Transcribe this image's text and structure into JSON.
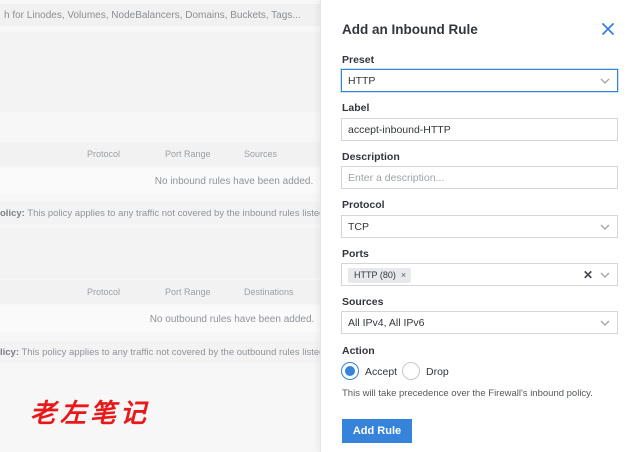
{
  "background": {
    "search_text": "h for Linodes, Volumes, NodeBalancers, Domains, Buckets, Tags...",
    "inbound_headers": [
      "Protocol",
      "Port Range",
      "Sources"
    ],
    "inbound_empty": "No inbound rules have been added.",
    "inbound_policy_label": "olicy:",
    "inbound_policy_text": " This policy applies to any traffic not covered by the inbound rules listed a",
    "outbound_headers": [
      "Protocol",
      "Port Range",
      "Destinations"
    ],
    "outbound_empty": "No outbound rules have been added.",
    "outbound_policy_label": "licy:",
    "outbound_policy_text": " This policy applies to any traffic not covered by the outbound rules listed a",
    "watermark": "老左笔记"
  },
  "drawer": {
    "title": "Add an Inbound Rule",
    "close_icon": "close-icon",
    "preset": {
      "label": "Preset",
      "value": "HTTP"
    },
    "label_field": {
      "label": "Label",
      "value": "accept-inbound-HTTP"
    },
    "description": {
      "label": "Description",
      "placeholder": "Enter a description..."
    },
    "protocol": {
      "label": "Protocol",
      "value": "TCP"
    },
    "ports": {
      "label": "Ports",
      "chip": "HTTP (80)",
      "chip_remove": "×",
      "clear": "✕"
    },
    "sources": {
      "label": "Sources",
      "value": "All IPv4, All IPv6"
    },
    "action": {
      "label": "Action",
      "options": [
        {
          "label": "Accept",
          "checked": true
        },
        {
          "label": "Drop",
          "checked": false
        }
      ],
      "note": "This will take precedence over the Firewall's inbound policy."
    },
    "submit_label": "Add Rule"
  },
  "colors": {
    "accent": "#3683dc",
    "watermark": "#e8191a"
  }
}
